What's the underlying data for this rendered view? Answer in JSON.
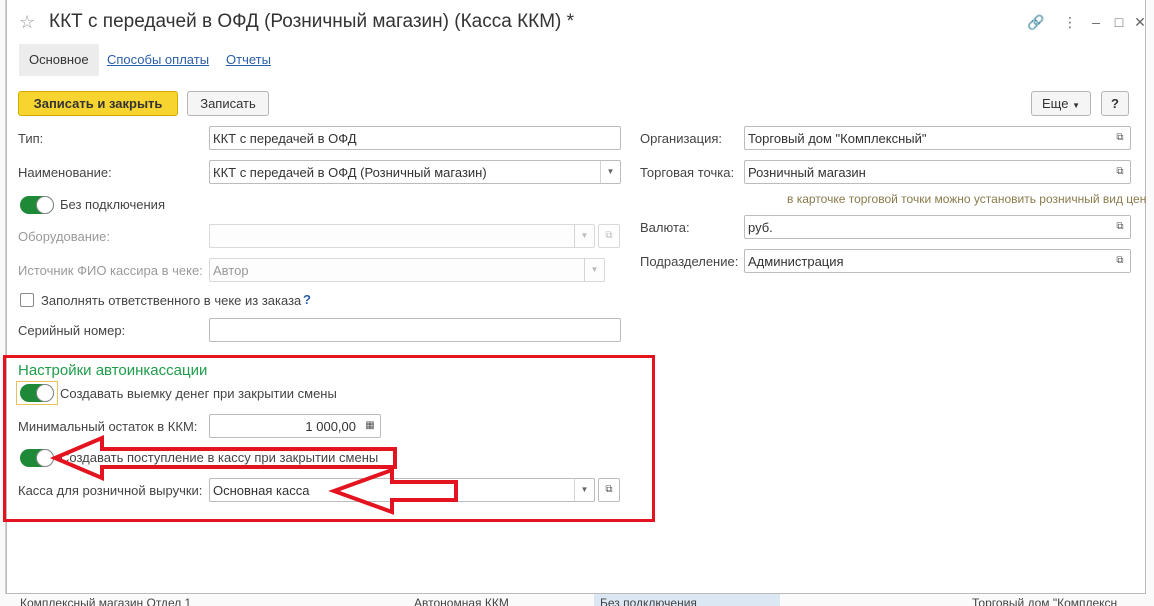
{
  "window": {
    "title": "ККТ с передачей в ОФД (Розничный магазин) (Касса ККМ) *"
  },
  "tabs": [
    {
      "label": "Основное",
      "active": true
    },
    {
      "label": "Способы оплаты",
      "active": false
    },
    {
      "label": "Отчеты",
      "active": false
    }
  ],
  "toolbar": {
    "save_close": "Записать и закрыть",
    "save": "Записать",
    "more": "Еще",
    "help": "?"
  },
  "left": {
    "type_label": "Тип:",
    "type_value": "ККТ с передачей в ОФД",
    "name_label": "Наименование:",
    "name_value": "ККТ с передачей в ОФД (Розничный магазин)",
    "no_connection": "Без подключения",
    "equipment_label": "Оборудование:",
    "equipment_value": "",
    "cashier_label": "Источник ФИО кассира в чеке:",
    "cashier_value": "Автор",
    "fill_responsible": "Заполнять ответственного в чеке из заказа",
    "help_mark": "?",
    "serial_label": "Серийный номер:",
    "serial_value": ""
  },
  "right": {
    "org_label": "Организация:",
    "org_value": "Торговый дом \"Комплексный\"",
    "point_label": "Торговая точка:",
    "point_value": "Розничный магазин",
    "point_hint": "в карточке торговой точки можно установить розничный вид цен",
    "currency_label": "Валюта:",
    "currency_value": "руб.",
    "division_label": "Подразделение:",
    "division_value": "Администрация"
  },
  "autocash": {
    "title": "Настройки автоинкассации",
    "create_withdrawal": "Создавать выемку денег при закрытии смены",
    "min_balance_label": "Минимальный остаток в ККМ:",
    "min_balance_value": "1 000,00",
    "create_receipt": "Создавать поступление в кассу при закрытии смены",
    "cashbox_label": "Касса для розничной выручки:",
    "cashbox_value": "Основная касса"
  },
  "background_bottom": {
    "col1": "Комплексный магазин Отдел 1",
    "col2": "Автономная ККМ",
    "col3": "Без подключения",
    "col4": "Торговый дом \"Комплексн"
  },
  "colors": {
    "accent_yellow": "#f7d430",
    "toggle_green": "#1e8a38",
    "group_title_green": "#1f9d4a",
    "link_blue": "#2a5ea8",
    "annotation_red": "#e3141f"
  }
}
